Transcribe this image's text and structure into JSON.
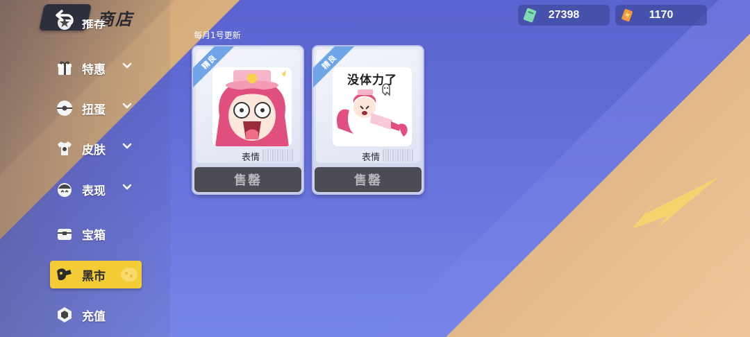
{
  "header": {
    "title": "商店",
    "back_icon": "back-arrow-icon"
  },
  "currencies": [
    {
      "icon": "green-ticket-icon",
      "value": "27398",
      "color": "#7fd9b3"
    },
    {
      "icon": "orange-crystal-icon",
      "value": "1170",
      "color": "#f29a3c"
    }
  ],
  "sidebar": {
    "items": [
      {
        "label": "推荐",
        "icon": "star-badge-icon",
        "has_chevron": false,
        "active": false
      },
      {
        "label": "特惠",
        "icon": "gift-box-icon",
        "has_chevron": true,
        "active": false
      },
      {
        "label": "扭蛋",
        "icon": "gacha-ball-icon",
        "has_chevron": true,
        "active": false
      },
      {
        "label": "皮肤",
        "icon": "shirt-icon",
        "has_chevron": true,
        "active": false
      },
      {
        "label": "表现",
        "icon": "emote-icon",
        "has_chevron": true,
        "active": false
      },
      {
        "label": "宝箱",
        "icon": "chest-icon",
        "has_chevron": false,
        "active": false
      },
      {
        "label": "黑市",
        "icon": "black-market-icon",
        "has_chevron": false,
        "active": true
      },
      {
        "label": "充值",
        "icon": "gem-icon",
        "has_chevron": false,
        "active": false
      }
    ],
    "active_color": "#f3cb35"
  },
  "main": {
    "update_note": "每月1号更新",
    "cards": [
      {
        "ribbon": "精良",
        "type": "表情",
        "button": "售罄",
        "sticker_caption": ""
      },
      {
        "ribbon": "精良",
        "type": "表情",
        "button": "售罄",
        "sticker_caption": "没体力了"
      }
    ]
  }
}
